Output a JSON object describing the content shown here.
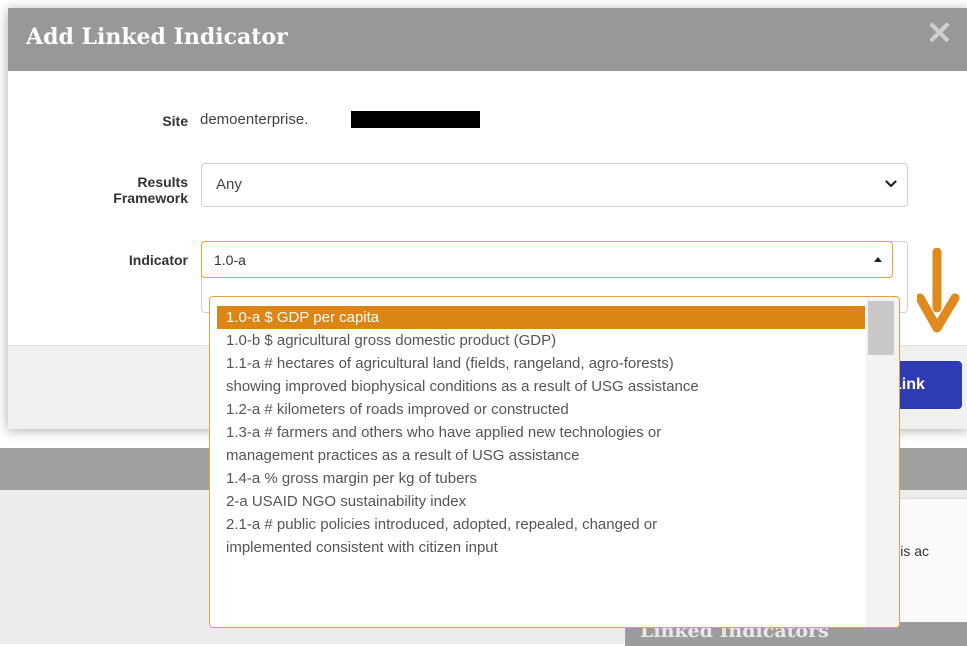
{
  "modal": {
    "title": "Add Linked Indicator",
    "close_glyph": "✕"
  },
  "form": {
    "site_label": "Site",
    "site_value": "demoenterprise.",
    "framework_label_line1": "Results",
    "framework_label_line2": "Framework",
    "framework_value": "Any",
    "indicator_label": "Indicator",
    "indicator_input_value": "1.0-a"
  },
  "dropdown": {
    "options": [
      [
        "1.0-a $ GDP per capita"
      ],
      [
        "1.0-b $ agricultural gross domestic product (GDP)"
      ],
      [
        "1.1-a # hectares of agricultural land (fields, rangeland, agro-forests)",
        "showing improved biophysical conditions as a result of USG assistance"
      ],
      [
        "1.2-a # kilometers of roads improved or constructed"
      ],
      [
        "1.3-a # farmers and others who have applied new technologies or",
        "management practices as a result of USG assistance"
      ],
      [
        "1.4-a % gross margin per kg of tubers"
      ],
      [
        "2-a USAID NGO sustainability index"
      ],
      [
        "2.1-a # public policies introduced, adopted, repealed, changed or",
        "implemented consistent with citizen input"
      ]
    ],
    "selected_index": 0
  },
  "footer": {
    "link_button_label": "Link"
  },
  "background": {
    "snippet_text": "tor is ac",
    "section_title": "Linked Indicators"
  },
  "colors": {
    "accent_orange": "#dc8514",
    "primary_button": "#2f3bb2",
    "header_gray": "#989898"
  }
}
